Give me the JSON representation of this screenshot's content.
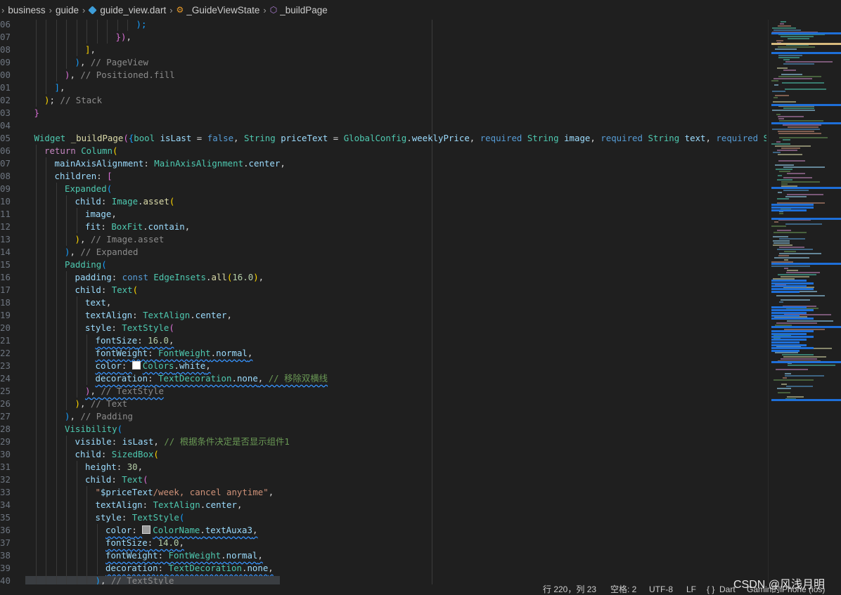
{
  "breadcrumb": {
    "items": [
      "business",
      "guide",
      "guide_view.dart",
      "_GuideViewState",
      "_buildPage"
    ]
  },
  "code_lines": [
    {
      "ln": "06",
      "indent": 11,
      "tokens": [
        [
          "p3",
          ");"
        ]
      ]
    },
    {
      "ln": "07",
      "indent": 9,
      "tokens": [
        [
          "p2",
          "}"
        ],
        [
          "p2",
          ")"
        ],
        [
          "w",
          ","
        ]
      ]
    },
    {
      "ln": "08",
      "indent": 6,
      "tokens": [
        [
          "p1",
          "]"
        ],
        [
          "w",
          ","
        ]
      ]
    },
    {
      "ln": "09",
      "indent": 5,
      "tokens": [
        [
          "p3",
          ")"
        ],
        [
          "w",
          ", "
        ],
        [
          "cm",
          "// PageView"
        ]
      ]
    },
    {
      "ln": "00",
      "indent": 4,
      "tokens": [
        [
          "p2",
          ")"
        ],
        [
          "w",
          ", "
        ],
        [
          "cm",
          "// Positioned.fill"
        ]
      ]
    },
    {
      "ln": "01",
      "indent": 3,
      "tokens": [
        [
          "p3",
          "]"
        ],
        [
          "w",
          ","
        ]
      ]
    },
    {
      "ln": "02",
      "indent": 2,
      "tokens": [
        [
          "p1",
          ")"
        ],
        [
          "w",
          "; "
        ],
        [
          "cm",
          "// Stack"
        ]
      ]
    },
    {
      "ln": "03",
      "indent": 1,
      "tokens": [
        [
          "p2",
          "}"
        ]
      ]
    },
    {
      "ln": "04",
      "indent": 0,
      "tokens": []
    },
    {
      "ln": "05",
      "indent": 1,
      "tokens": [
        [
          "t",
          "Widget "
        ],
        [
          "f",
          "_buildPage"
        ],
        [
          "p2",
          "("
        ],
        [
          "p3",
          "{"
        ],
        [
          "t",
          "bool "
        ],
        [
          "v",
          "isLast"
        ],
        [
          "w",
          " = "
        ],
        [
          "k",
          "false"
        ],
        [
          "w",
          ", "
        ],
        [
          "t",
          "String "
        ],
        [
          "v",
          "priceText"
        ],
        [
          "w",
          " = "
        ],
        [
          "t",
          "GlobalConfig"
        ],
        [
          "w",
          "."
        ],
        [
          "v",
          "weeklyPrice"
        ],
        [
          "w",
          ", "
        ],
        [
          "k",
          "required "
        ],
        [
          "t",
          "String "
        ],
        [
          "v",
          "image"
        ],
        [
          "w",
          ", "
        ],
        [
          "k",
          "required "
        ],
        [
          "t",
          "String "
        ],
        [
          "v",
          "text"
        ],
        [
          "w",
          ", "
        ],
        [
          "k",
          "required "
        ],
        [
          "t",
          "Strin"
        ]
      ]
    },
    {
      "ln": "06",
      "indent": 2,
      "tokens": [
        [
          "kc",
          "return "
        ],
        [
          "t",
          "Column"
        ],
        [
          "p1",
          "("
        ]
      ]
    },
    {
      "ln": "07",
      "indent": 3,
      "tokens": [
        [
          "v",
          "mainAxisAlignment"
        ],
        [
          "w",
          ": "
        ],
        [
          "t",
          "MainAxisAlignment"
        ],
        [
          "w",
          "."
        ],
        [
          "v",
          "center"
        ],
        [
          "w",
          ","
        ]
      ]
    },
    {
      "ln": "08",
      "indent": 3,
      "tokens": [
        [
          "v",
          "children"
        ],
        [
          "w",
          ": "
        ],
        [
          "p2",
          "["
        ]
      ]
    },
    {
      "ln": "09",
      "indent": 4,
      "tokens": [
        [
          "t",
          "Expanded"
        ],
        [
          "p3",
          "("
        ]
      ]
    },
    {
      "ln": "10",
      "indent": 5,
      "tokens": [
        [
          "v",
          "child"
        ],
        [
          "w",
          ": "
        ],
        [
          "t",
          "Image"
        ],
        [
          "w",
          "."
        ],
        [
          "f",
          "asset"
        ],
        [
          "p1",
          "("
        ]
      ]
    },
    {
      "ln": "11",
      "indent": 6,
      "tokens": [
        [
          "v",
          "image"
        ],
        [
          "w",
          ","
        ]
      ]
    },
    {
      "ln": "12",
      "indent": 6,
      "tokens": [
        [
          "v",
          "fit"
        ],
        [
          "w",
          ": "
        ],
        [
          "t",
          "BoxFit"
        ],
        [
          "w",
          "."
        ],
        [
          "v",
          "contain"
        ],
        [
          "w",
          ","
        ]
      ]
    },
    {
      "ln": "13",
      "indent": 5,
      "tokens": [
        [
          "p1",
          ")"
        ],
        [
          "w",
          ", "
        ],
        [
          "cm",
          "// Image.asset"
        ]
      ]
    },
    {
      "ln": "14",
      "indent": 4,
      "tokens": [
        [
          "p3",
          ")"
        ],
        [
          "w",
          ", "
        ],
        [
          "cm",
          "// Expanded"
        ]
      ]
    },
    {
      "ln": "15",
      "indent": 4,
      "tokens": [
        [
          "t",
          "Padding"
        ],
        [
          "p3",
          "("
        ]
      ]
    },
    {
      "ln": "16",
      "indent": 5,
      "tokens": [
        [
          "v",
          "padding"
        ],
        [
          "w",
          ": "
        ],
        [
          "k",
          "const "
        ],
        [
          "t",
          "EdgeInsets"
        ],
        [
          "w",
          "."
        ],
        [
          "f",
          "all"
        ],
        [
          "p1",
          "("
        ],
        [
          "n",
          "16.0"
        ],
        [
          "p1",
          ")"
        ],
        [
          "w",
          ","
        ]
      ]
    },
    {
      "ln": "17",
      "indent": 5,
      "tokens": [
        [
          "v",
          "child"
        ],
        [
          "w",
          ": "
        ],
        [
          "t",
          "Text"
        ],
        [
          "p1",
          "("
        ]
      ]
    },
    {
      "ln": "18",
      "indent": 6,
      "tokens": [
        [
          "v",
          "text"
        ],
        [
          "w",
          ","
        ]
      ]
    },
    {
      "ln": "19",
      "indent": 6,
      "tokens": [
        [
          "v",
          "textAlign"
        ],
        [
          "w",
          ": "
        ],
        [
          "t",
          "TextAlign"
        ],
        [
          "w",
          "."
        ],
        [
          "v",
          "center"
        ],
        [
          "w",
          ","
        ]
      ]
    },
    {
      "ln": "20",
      "indent": 6,
      "tokens": [
        [
          "v",
          "style"
        ],
        [
          "w",
          ": "
        ],
        [
          "t",
          "TextStyle"
        ],
        [
          "p2",
          "("
        ]
      ]
    },
    {
      "ln": "21",
      "indent": 7,
      "squiggle": true,
      "tokens": [
        [
          "v",
          "fontSize"
        ],
        [
          "w",
          ": "
        ],
        [
          "n",
          "16.0"
        ],
        [
          "w",
          ","
        ]
      ]
    },
    {
      "ln": "22",
      "indent": 7,
      "squiggle": true,
      "tokens": [
        [
          "v",
          "fontWeight"
        ],
        [
          "w",
          ": "
        ],
        [
          "t",
          "FontWeight"
        ],
        [
          "w",
          "."
        ],
        [
          "v",
          "normal"
        ],
        [
          "w",
          ","
        ]
      ]
    },
    {
      "ln": "23",
      "indent": 7,
      "squiggle": true,
      "swatch": "#ffffff",
      "tokens": [
        [
          "v",
          "color"
        ],
        [
          "w",
          ": "
        ],
        [
          "SW",
          ""
        ],
        [
          "t",
          "Colors"
        ],
        [
          "w",
          "."
        ],
        [
          "v",
          "white"
        ],
        [
          "w",
          ","
        ]
      ]
    },
    {
      "ln": "24",
      "indent": 7,
      "squiggle": true,
      "tokens": [
        [
          "v",
          "decoration"
        ],
        [
          "w",
          ": "
        ],
        [
          "t",
          "TextDecoration"
        ],
        [
          "w",
          "."
        ],
        [
          "v",
          "none"
        ],
        [
          "w",
          ", "
        ],
        [
          "c",
          "// 移除双横线"
        ]
      ]
    },
    {
      "ln": "25",
      "indent": 6,
      "squiggle": true,
      "tokens": [
        [
          "p2",
          ")"
        ],
        [
          "w",
          ", "
        ],
        [
          "cm",
          "// TextStyle"
        ]
      ]
    },
    {
      "ln": "26",
      "indent": 5,
      "tokens": [
        [
          "p1",
          ")"
        ],
        [
          "w",
          ", "
        ],
        [
          "cm",
          "// Text"
        ]
      ]
    },
    {
      "ln": "27",
      "indent": 4,
      "tokens": [
        [
          "p3",
          ")"
        ],
        [
          "w",
          ", "
        ],
        [
          "cm",
          "// Padding"
        ]
      ]
    },
    {
      "ln": "28",
      "indent": 4,
      "tokens": [
        [
          "t",
          "Visibility"
        ],
        [
          "p3",
          "("
        ]
      ]
    },
    {
      "ln": "29",
      "indent": 5,
      "tokens": [
        [
          "v",
          "visible"
        ],
        [
          "w",
          ": "
        ],
        [
          "v",
          "isLast"
        ],
        [
          "w",
          ", "
        ],
        [
          "c",
          "// 根据条件决定是否显示组件1"
        ]
      ]
    },
    {
      "ln": "30",
      "indent": 5,
      "tokens": [
        [
          "v",
          "child"
        ],
        [
          "w",
          ": "
        ],
        [
          "t",
          "SizedBox"
        ],
        [
          "p1",
          "("
        ]
      ]
    },
    {
      "ln": "31",
      "indent": 6,
      "tokens": [
        [
          "v",
          "height"
        ],
        [
          "w",
          ": "
        ],
        [
          "n",
          "30"
        ],
        [
          "w",
          ","
        ]
      ]
    },
    {
      "ln": "32",
      "indent": 6,
      "tokens": [
        [
          "v",
          "child"
        ],
        [
          "w",
          ": "
        ],
        [
          "t",
          "Text"
        ],
        [
          "p2",
          "("
        ]
      ]
    },
    {
      "ln": "33",
      "indent": 7,
      "tokens": [
        [
          "s",
          "\""
        ],
        [
          "v",
          "$priceText"
        ],
        [
          "s",
          "/week, cancel anytime\""
        ],
        [
          "w",
          ","
        ]
      ]
    },
    {
      "ln": "34",
      "indent": 7,
      "tokens": [
        [
          "v",
          "textAlign"
        ],
        [
          "w",
          ": "
        ],
        [
          "t",
          "TextAlign"
        ],
        [
          "w",
          "."
        ],
        [
          "v",
          "center"
        ],
        [
          "w",
          ","
        ]
      ]
    },
    {
      "ln": "35",
      "indent": 7,
      "tokens": [
        [
          "v",
          "style"
        ],
        [
          "w",
          ": "
        ],
        [
          "t",
          "TextStyle"
        ],
        [
          "p3",
          "("
        ]
      ]
    },
    {
      "ln": "36",
      "indent": 8,
      "squiggle": true,
      "swatch": "#9a9a9a",
      "tokens": [
        [
          "v",
          "color"
        ],
        [
          "w",
          ": "
        ],
        [
          "SW",
          ""
        ],
        [
          "t",
          "ColorName"
        ],
        [
          "w",
          "."
        ],
        [
          "v",
          "textAuxa3"
        ],
        [
          "w",
          ","
        ]
      ]
    },
    {
      "ln": "37",
      "indent": 8,
      "squiggle": true,
      "tokens": [
        [
          "v",
          "fontSize"
        ],
        [
          "w",
          ": "
        ],
        [
          "n",
          "14.0"
        ],
        [
          "w",
          ","
        ]
      ]
    },
    {
      "ln": "38",
      "indent": 8,
      "squiggle": true,
      "tokens": [
        [
          "v",
          "fontWeight"
        ],
        [
          "w",
          ": "
        ],
        [
          "t",
          "FontWeight"
        ],
        [
          "w",
          "."
        ],
        [
          "v",
          "normal"
        ],
        [
          "w",
          ","
        ]
      ]
    },
    {
      "ln": "39",
      "indent": 8,
      "squiggle": true,
      "tokens": [
        [
          "v",
          "decoration"
        ],
        [
          "w",
          ": "
        ],
        [
          "t",
          "TextDecoration"
        ],
        [
          "w",
          "."
        ],
        [
          "v",
          "none"
        ],
        [
          "w",
          ","
        ]
      ]
    },
    {
      "ln": "40",
      "indent": 7,
      "highlight": true,
      "tokens": [
        [
          "p3",
          ")"
        ],
        [
          "w",
          ", "
        ],
        [
          "cm",
          "// TextStyle"
        ]
      ]
    }
  ],
  "status": {
    "position": "行 220，列 23",
    "indent": "空格: 2",
    "encoding": "UTF-8",
    "eol": "LF",
    "braces": "{ }",
    "language": "Dart",
    "device": "Gamin的iPhone (ios)"
  },
  "watermark": "CSDN @风浅月明",
  "colors": {
    "background": "#1f1f1f",
    "type": "#4ec9b0",
    "function": "#dcdcaa",
    "variable": "#9cdcfe",
    "keyword": "#569cd6",
    "comment": "#6a9955",
    "string": "#ce9178",
    "number": "#b5cea8",
    "squiggle": "#3794ff"
  }
}
